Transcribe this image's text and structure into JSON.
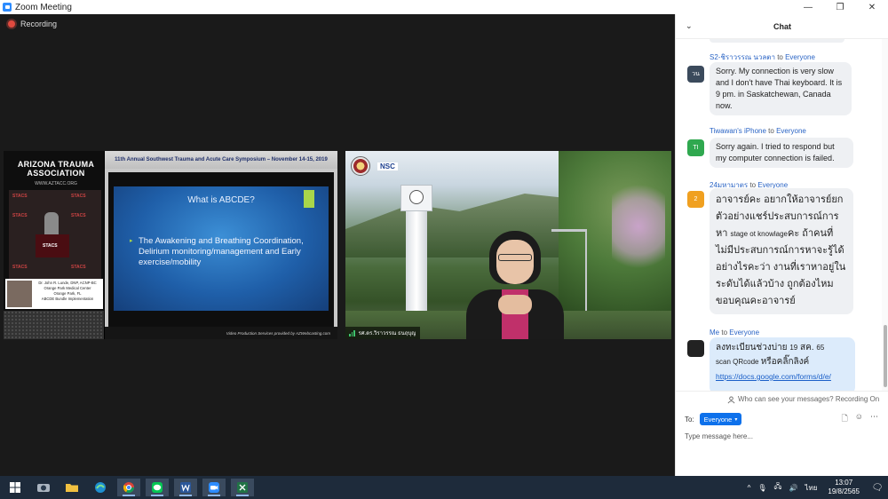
{
  "window": {
    "title": "Zoom Meeting",
    "controls": {
      "minimize": "—",
      "maximize": "❐",
      "close": "✕"
    }
  },
  "meeting": {
    "recording_label": "Recording",
    "left_video": {
      "org_name": "ARIZONA TRAUMA ASSOCIATION",
      "org_url": "WWW.AZTACC.ORG",
      "stage_logo": "STACS",
      "presenter_lines": [
        "Dr. John R. Lunde, DNP, ACNP-BC",
        "Orange Park Medical Center",
        "Orange Park, FL",
        "ABCDE Bundle Implementation"
      ],
      "slide_header": "11th Annual Southwest Trauma and Acute Care Symposium – November 14-15, 2019",
      "slide_title": "What is ABCDE?",
      "slide_bullet": "The Awakening and Breathing Coordination, Delirium monitoring/management and Early exercise/mobility",
      "slide_footer": "Video Production Services provided by AZWebcasting.com"
    },
    "right_video": {
      "logo_text": "NSC",
      "participant_name": "รศ.ดร.วิราวรรณ ธนฤบุญ"
    }
  },
  "chat": {
    "header_title": "Chat",
    "messages": [
      {
        "sender": "S2-ชิราวรรณ นวลตา",
        "to_word": "to",
        "recipient": "Everyone",
        "avatar_text": "วน",
        "avatar_color": "#3b4a5c",
        "text": "Sorry. My connection is very slow and I don't have Thai keyboard. It is 9 pm. in Saskatchewan, Canada now."
      },
      {
        "sender": "Tiwawan's iPhone",
        "to_word": "to",
        "recipient": "Everyone",
        "avatar_text": "TI",
        "avatar_color": "#2fa84f",
        "text": "Sorry again. I tried to respond but my computer connection is failed."
      },
      {
        "sender": "24มหามาตร",
        "to_word": "to",
        "recipient": "Everyone",
        "avatar_text": "2",
        "avatar_color": "#f0a020",
        "text_part1": "อาจารย์คะ อยากให้อาจารย์ยกตัวอย่างแชร์ประสบการณ์การหา ",
        "text_part2": "stage ot knowlage",
        "text_part3": "คะ ถ้าคนที่ไม่มีประสบการณ์การหาจะรู้ได้อย่างไรคะว่า งานที่เราหาอยู่ในระดับได้แล้วบ้าง ถูกต้องไหม ขอบคุณคะอาจารย์"
      },
      {
        "sender": "Me",
        "to_word": "to",
        "recipient": "Everyone",
        "avatar_color": "#222222",
        "text_part1": "ลงทะเบียนช่วงบ่าย ",
        "text_part2": "19",
        "text_part3": " สค. ",
        "text_part4": "65",
        "text_part5": "scan QRcode ",
        "text_part6": "หรือคลิ๊กลิงค์",
        "link": "https://docs.google.com/forms/d/e/"
      }
    ],
    "who_can_see": "Who can see your messages? Recording On",
    "to_label": "To:",
    "recipient_button": "Everyone",
    "input_placeholder": "Type message here..."
  },
  "taskbar": {
    "apps": [
      "windows-start",
      "camera",
      "file-explorer",
      "edge",
      "chrome",
      "line",
      "word",
      "zoom",
      "excel"
    ],
    "tray": {
      "chevron": "^",
      "language": "ไทย",
      "time": "13:07",
      "date": "19/8/2565"
    }
  }
}
